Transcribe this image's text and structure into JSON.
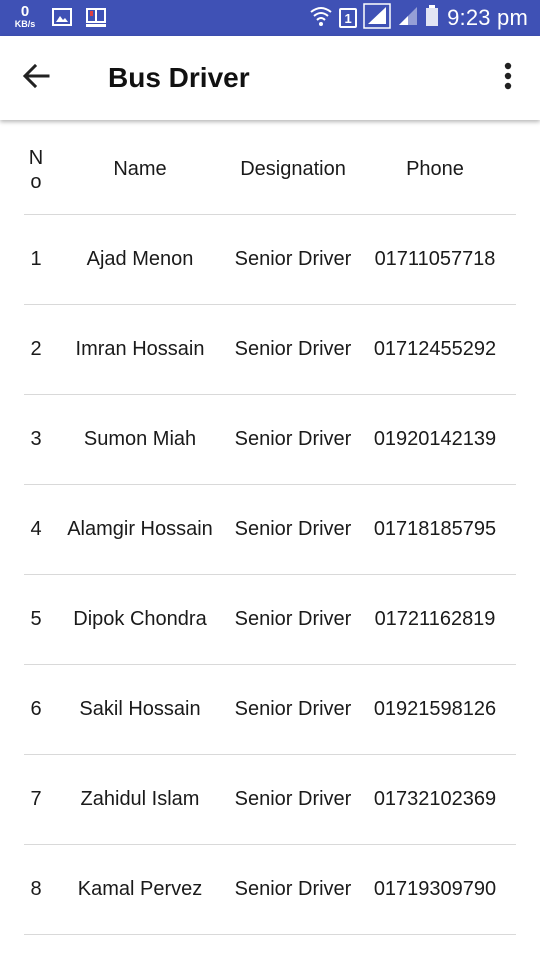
{
  "status_bar": {
    "net_speed_value": "0",
    "net_speed_unit": "KB/s",
    "sim_label": "1",
    "time": "9:23 pm",
    "icons": [
      "gallery-icon",
      "book-icon",
      "wifi-icon",
      "signal-icon",
      "signal-weak-icon",
      "battery-icon"
    ]
  },
  "app_bar": {
    "title": "Bus Driver",
    "back_icon": "arrow-left-icon",
    "menu_icon": "more-vert-icon"
  },
  "table": {
    "headers": {
      "no_line1": "N",
      "no_line2": "o",
      "name": "Name",
      "designation": "Designation",
      "phone": "Phone"
    },
    "rows": [
      {
        "no": "1",
        "name": "Ajad Menon",
        "designation": "Senior Driver",
        "phone": "01711057718"
      },
      {
        "no": "2",
        "name": "Imran Hossain",
        "designation": "Senior Driver",
        "phone": "01712455292"
      },
      {
        "no": "3",
        "name": "Sumon Miah",
        "designation": "Senior Driver",
        "phone": "01920142139"
      },
      {
        "no": "4",
        "name": "Alamgir Hossain",
        "designation": "Senior Driver",
        "phone": "01718185795"
      },
      {
        "no": "5",
        "name": "Dipok Chondra",
        "designation": "Senior Driver",
        "phone": "01721162819"
      },
      {
        "no": "6",
        "name": "Sakil Hossain",
        "designation": "Senior Driver",
        "phone": "01921598126"
      },
      {
        "no": "7",
        "name": "Zahidul Islam",
        "designation": "Senior Driver",
        "phone": "01732102369"
      },
      {
        "no": "8",
        "name": "Kamal Pervez",
        "designation": "Senior Driver",
        "phone": "01719309790"
      }
    ]
  },
  "colors": {
    "status_bar": "#3f51b5",
    "app_bar": "#ffffff",
    "divider": "#d9d9d9",
    "text": "#1a1a1a"
  }
}
